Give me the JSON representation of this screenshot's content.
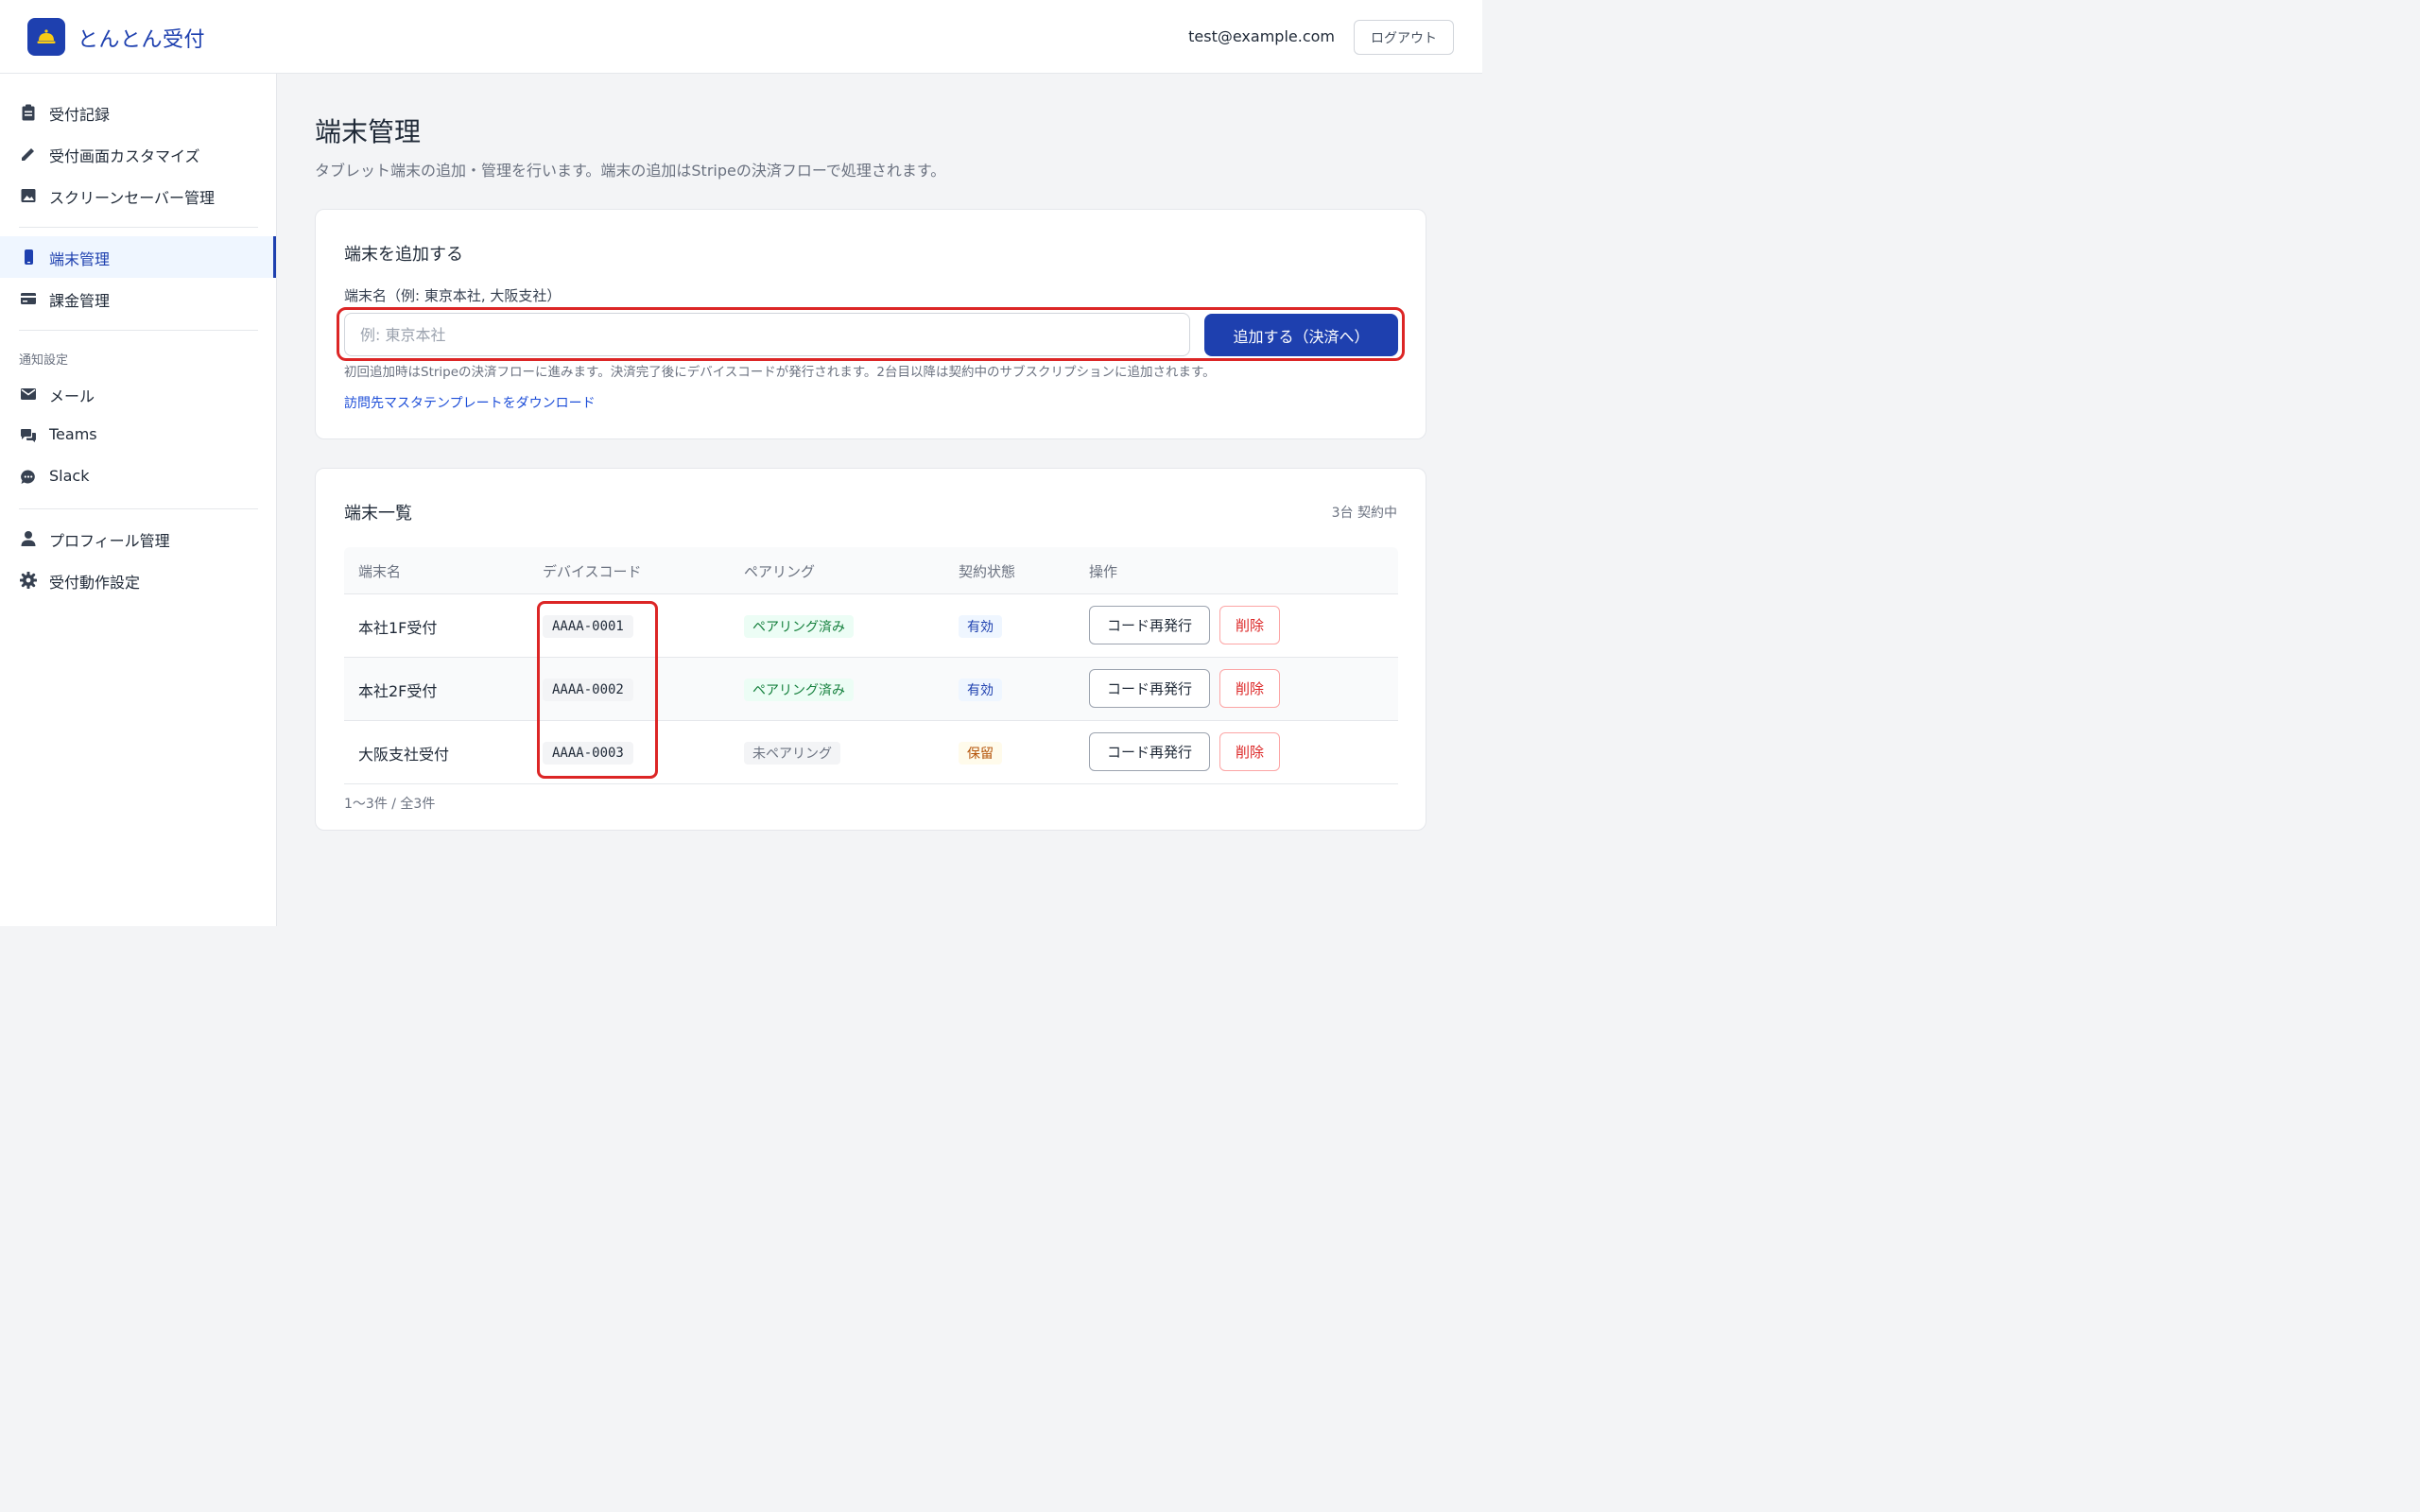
{
  "header": {
    "app_title": "とんとん受付",
    "logo_icon": "bell-icon",
    "user_email": "test@example.com",
    "logout_label": "ログアウト"
  },
  "sidebar": {
    "items": [
      {
        "label": "受付記録",
        "icon": "clipboard-icon"
      },
      {
        "label": "受付画面カスタマイズ",
        "icon": "pencil-icon"
      },
      {
        "label": "スクリーンセーバー管理",
        "icon": "image-icon"
      },
      {
        "label": "端末管理",
        "icon": "tablet-icon",
        "active": true
      },
      {
        "label": "課金管理",
        "icon": "credit-card-icon"
      }
    ],
    "notify_section_title": "通知設定",
    "notify_items": [
      {
        "label": "メール",
        "icon": "mail-icon"
      },
      {
        "label": "Teams",
        "icon": "chat-icon"
      },
      {
        "label": "Slack",
        "icon": "message-icon"
      }
    ],
    "bottom_items": [
      {
        "label": "プロフィール管理",
        "icon": "person-icon"
      },
      {
        "label": "受付動作設定",
        "icon": "gear-icon"
      }
    ]
  },
  "main": {
    "title": "端末管理",
    "description": "タブレット端末の追加・管理を行います。端末の追加はStripeの決済フローで処理されます。",
    "add_card": {
      "title": "端末を追加する",
      "field_label": "端末名（例: 東京本社, 大阪支社）",
      "input_placeholder": "例: 東京本社",
      "input_value": "",
      "submit_label": "追加する（決済へ）",
      "help_text": "初回追加時はStripeの決済フローに進みます。決済完了後にデバイスコードが発行されます。2台目以降は契約中のサブスクリプションに追加されます。",
      "download_link": "訪問先マスタテンプレートをダウンロード"
    },
    "list_card": {
      "title": "端末一覧",
      "count_text": "3台 契約中",
      "columns": [
        "端末名",
        "デバイスコード",
        "ペアリング",
        "契約状態",
        "操作"
      ],
      "rows": [
        {
          "name": "本社1F受付",
          "code": "AAAA-0001",
          "pairing": "ペアリング済み",
          "pairing_state": "paired",
          "status": "有効",
          "status_state": "active"
        },
        {
          "name": "本社2F受付",
          "code": "AAAA-0002",
          "pairing": "ペアリング済み",
          "pairing_state": "paired",
          "status": "有効",
          "status_state": "active"
        },
        {
          "name": "大阪支社受付",
          "code": "AAAA-0003",
          "pairing": "未ペアリング",
          "pairing_state": "unpaired",
          "status": "保留",
          "status_state": "hold"
        }
      ],
      "reissue_label": "コード再発行",
      "delete_label": "削除",
      "pagination": "1〜3件 / 全3件"
    }
  },
  "colors": {
    "brand": "#1e40af",
    "highlight": "#dc2626",
    "paired": "#15803d",
    "hold": "#b45309"
  }
}
